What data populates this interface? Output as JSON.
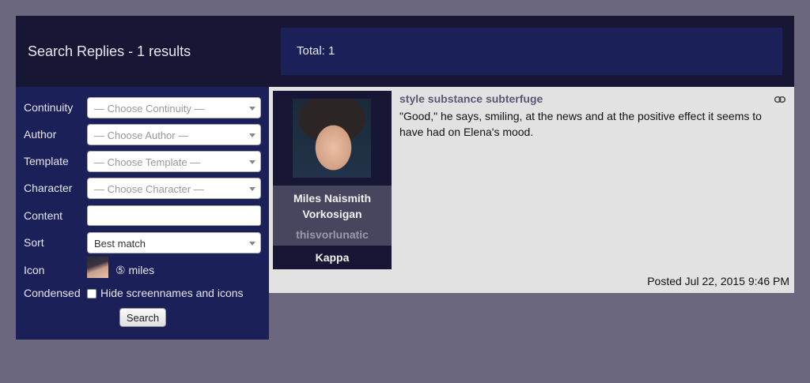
{
  "header": {
    "title": "Search Replies - 1 results",
    "total": "Total: 1"
  },
  "sidebar": {
    "continuity": {
      "label": "Continuity",
      "placeholder": "— Choose Continuity —"
    },
    "author": {
      "label": "Author",
      "placeholder": "— Choose Author —"
    },
    "template": {
      "label": "Template",
      "placeholder": "— Choose Template —"
    },
    "character": {
      "label": "Character",
      "placeholder": "— Choose Character —"
    },
    "content": {
      "label": "Content",
      "value": ""
    },
    "sort": {
      "label": "Sort",
      "value": "Best match"
    },
    "icon": {
      "label": "Icon",
      "value": "⑤ miles"
    },
    "condensed": {
      "label": "Condensed",
      "checkbox_label": "Hide screennames and icons",
      "checked": false
    },
    "search_button": "Search"
  },
  "result": {
    "character_name": "Miles Naismith Vorkosigan",
    "screenname": "thisvorlunatic",
    "template": "Kappa",
    "subject": "style substance subterfuge",
    "body": "\"Good,\" he says, smiling, at the news and at the positive effect it seems to have had on Elena's mood.",
    "posted": "Posted Jul 22, 2015 9:46 PM",
    "link_icon": "link-icon"
  },
  "colors": {
    "page_bg": "#6b677f",
    "header_bg": "#171735",
    "panel_bg": "#1b2158",
    "result_bg": "#e2e2e2",
    "subject_color": "#5b5876"
  }
}
